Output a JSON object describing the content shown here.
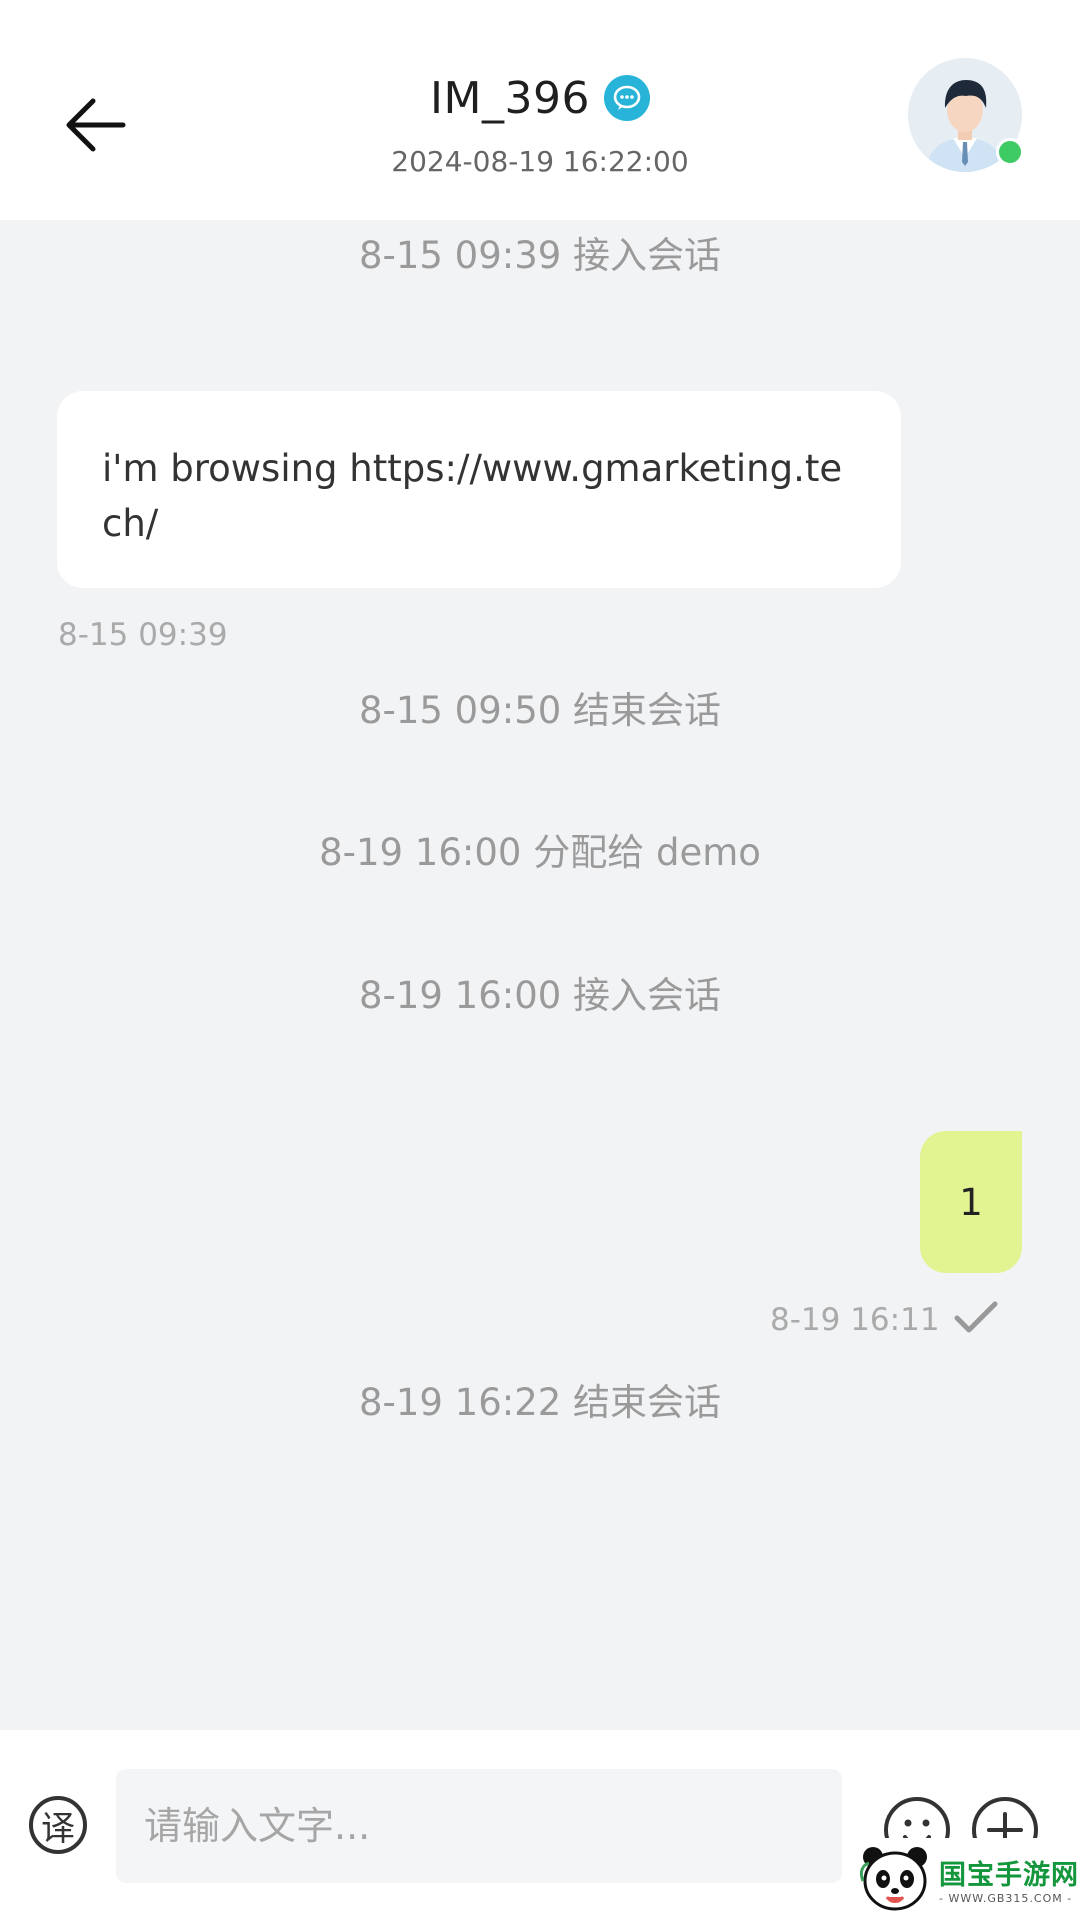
{
  "header": {
    "title": "IM_396",
    "subtitle": "2024-08-19 16:22:00",
    "chat_icon": "chat-bubble-icon",
    "back_icon": "arrow-left-icon",
    "avatar_icon": "user-avatar-icon",
    "online_color": "#3fcb63"
  },
  "messages": {
    "note_1": "8-15 09:39 接入会话",
    "incoming_text": "i'm browsing https://www.gmarketing.tech/",
    "incoming_time": "8-15 09:39",
    "note_2": "8-15 09:50 结束会话",
    "note_3": "8-19 16:00 分配给 demo",
    "note_4": "8-19 16:00 接入会话",
    "outgoing_text": "1",
    "outgoing_time": "8-19 16:11",
    "outgoing_status_icon": "check-icon",
    "note_5": "8-19 16:22 结束会话"
  },
  "input_bar": {
    "translate_label": "译",
    "placeholder": "请输入文字...",
    "emoji_icon": "emoji-icon",
    "plus_icon": "plus-icon"
  },
  "watermark": {
    "brand": "国宝手游网",
    "domain": "- WWW.GB315.COM -"
  },
  "colors": {
    "outgoing_bubble": "#e2f392",
    "background": "#f2f3f5",
    "badge": "#27b4d8"
  }
}
